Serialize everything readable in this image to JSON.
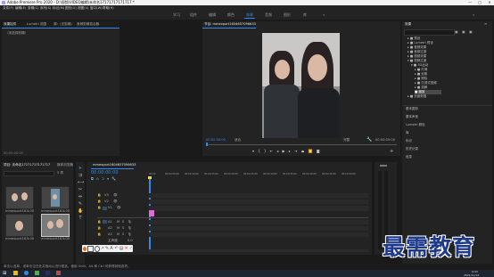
{
  "title_bar": {
    "title": "Adobe Premiere Pro 2020 - D:\\视频\\VIDEO编辑\\未命名17171717171717 *",
    "minimize": "—",
    "maximize": "□",
    "close": "✕"
  },
  "menu": [
    "文件(F)",
    "编辑(E)",
    "剪辑(C)",
    "序列(S)",
    "标记(M)",
    "图形(G)",
    "视图(V)",
    "窗口(W)",
    "帮助(H)"
  ],
  "workspaces": [
    "学习",
    "组件",
    "编辑",
    "颜色",
    "效果",
    "音频",
    "图形",
    "库"
  ],
  "active_workspace": "效果",
  "source_panel": {
    "tabs": [
      "效果控件",
      "Lumetri 范围",
      "源：(无剪辑)",
      "音频剪辑混合器"
    ],
    "active_tab": "效果控件",
    "no_clip": "（未选择剪辑）",
    "timecode": "00:00:00:00"
  },
  "program": {
    "tab": "节目: mmexport1604657096633",
    "timecode_left": "00:00:00:00",
    "fit": "适合",
    "quality": "完整",
    "timecode_right": "00:00:05:00"
  },
  "effects": {
    "title": "效果",
    "search_placeholder": "",
    "tree": [
      "预设",
      "Lumetri 预设",
      "音频效果",
      "音频过渡",
      "视频效果",
      "视频过渡",
      "3D运动",
      "内滑",
      "划像",
      "擦除",
      "沉浸式视频",
      "溶解",
      "缩放",
      "页面剥落"
    ],
    "selected": "页面剥落",
    "sections": [
      "基本图形",
      "基本声音",
      "Lumetri 颜色",
      "库",
      "标记",
      "历史记录",
      "信息"
    ]
  },
  "project": {
    "tab": "项目: 未命名17171717171717",
    "subtab": "媒体浏览器",
    "item_count": "5 项",
    "items": [
      {
        "name": "mmexport16...",
        "duration": "5:00"
      },
      {
        "name": "mmexport16...",
        "duration": "5:00"
      },
      {
        "name": "mmexport16...",
        "duration": "5:00"
      },
      {
        "name": "mmexport16...",
        "duration": "5:00"
      }
    ]
  },
  "timeline": {
    "tab": "mmexport1604657096633",
    "timecode": "00:00:00:00",
    "ruler": [
      "00:00",
      "00:00:05:00",
      "00:00:10:00",
      "00:00:15:00",
      "00:00:20:00",
      "00:00:25:00",
      "00:00:30:00",
      "00:00:35:00",
      "00:00:40:00",
      "00:00:45:00",
      "00:00:50:00",
      "00:00:55:00",
      "00:01:00:00"
    ],
    "video_tracks": [
      "V3",
      "V2",
      "V1"
    ],
    "audio_tracks": [
      "A1",
      "A2",
      "A3"
    ],
    "master": "主声道",
    "master_value": "0.0"
  },
  "status": {
    "text": "单击以选择，或单击空白处并拖动以进行框选。使用 Shift、Alt 和 Ctrl 可获得其他选项。"
  },
  "watermark": "最需教育",
  "clock": {
    "time": "9:43",
    "date": "2021/11/12"
  }
}
